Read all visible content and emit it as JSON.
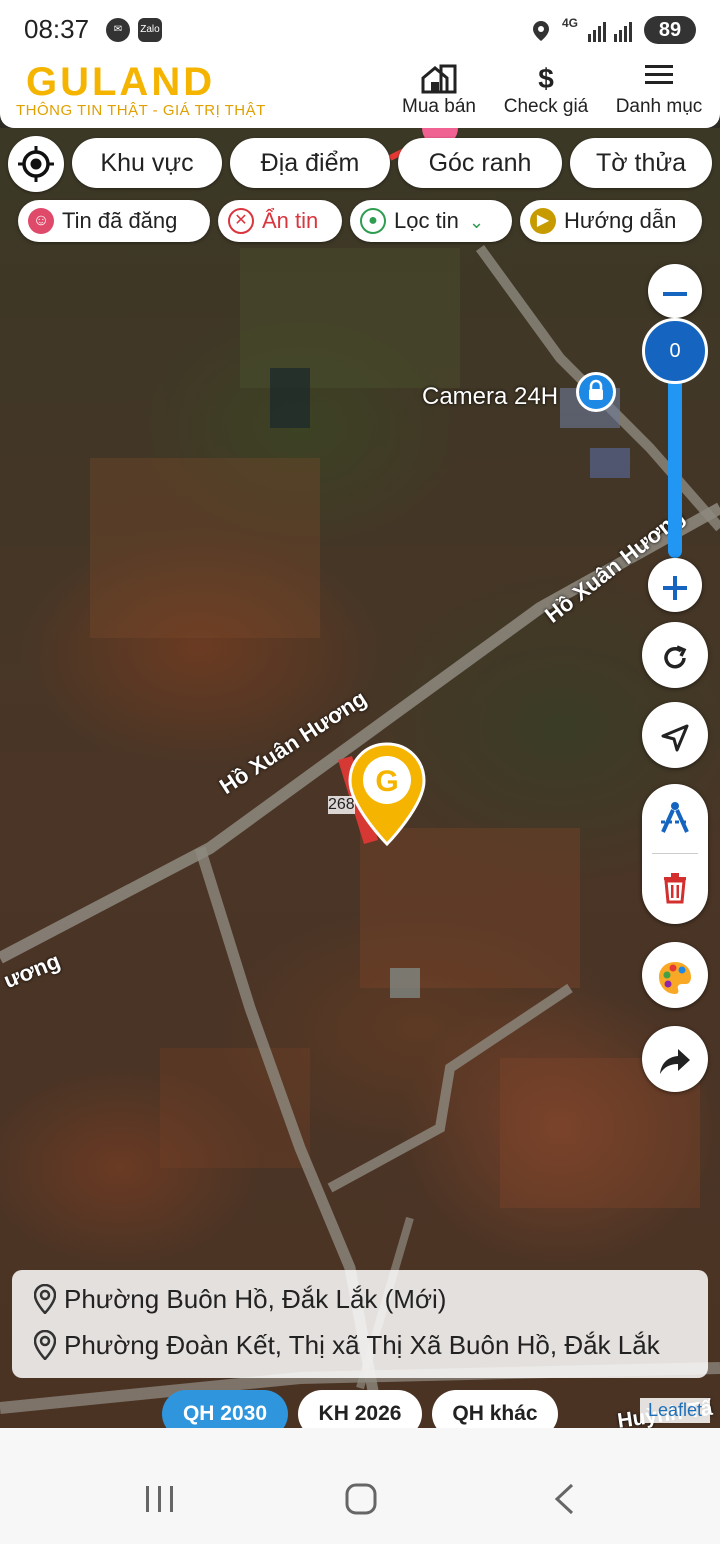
{
  "status_bar": {
    "time": "08:37",
    "messenger_icon": "messenger-icon",
    "zalo_label": "Zalo",
    "network": "4G",
    "battery": "89"
  },
  "header": {
    "logo": "GULAND",
    "tagline": "THÔNG TIN THẬT - GIÁ TRỊ THẬT",
    "nav": [
      {
        "label": "Mua bán",
        "icon": "house-icon"
      },
      {
        "label": "Check giá",
        "icon": "dollar-icon"
      },
      {
        "label": "Danh mục",
        "icon": "menu-icon"
      }
    ]
  },
  "toolbar": {
    "filters": [
      "Khu vực",
      "Địa điểm",
      "Góc ranh",
      "Tờ thửa"
    ],
    "chips": [
      {
        "label": "Tin đã đăng",
        "color": "#e04a6a"
      },
      {
        "label": "Ẩn tin",
        "color": "#d9363e"
      },
      {
        "label": "Lọc tin",
        "color": "#2e9d4f"
      },
      {
        "label": "Hướng dẫn",
        "color": "#c79a00"
      }
    ]
  },
  "map": {
    "zoom_value": "0",
    "labels": {
      "camera": "Camera 24H",
      "road1": "Hồ Xuân Hương",
      "road2": "Hồ Xuân Hương",
      "road3": "ương",
      "road4": "Huỳnh Tấ",
      "parcel": "268",
      "attribution": "Leaflet"
    },
    "accent": "#f4b400"
  },
  "location": {
    "line1": "Phường Buôn Hồ, Đắk Lắk (Mới)",
    "line2": "Phường Đoàn Kết, Thị xã Thị Xã Buôn Hồ, Đắk Lắk"
  },
  "plan_buttons": [
    {
      "label": "QH 2030",
      "active": true
    },
    {
      "label": "KH 2026",
      "active": false
    },
    {
      "label": "QH khác",
      "active": false
    }
  ]
}
